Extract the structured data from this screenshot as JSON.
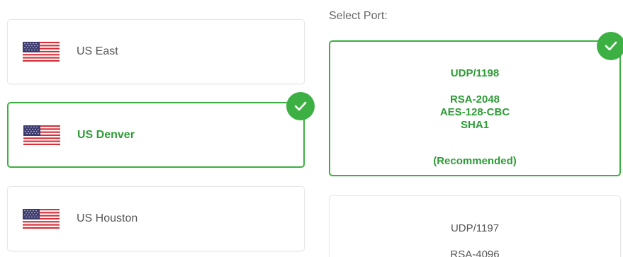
{
  "regions": [
    {
      "label": "US East",
      "selected": false
    },
    {
      "label": "US Denver",
      "selected": true
    },
    {
      "label": "US Houston",
      "selected": false
    }
  ],
  "port_section": {
    "heading": "Select Port:",
    "options": [
      {
        "selected": true,
        "port": "UDP/1198",
        "lines": [
          "RSA-2048",
          "AES-128-CBC",
          "SHA1"
        ],
        "note": "(Recommended)"
      },
      {
        "selected": false,
        "port": "UDP/1197",
        "lines": [
          "RSA-4096"
        ]
      }
    ]
  },
  "colors": {
    "accent_green": "#3db043",
    "selected_text": "#2d9c36",
    "card_border": "#e6e6e6",
    "text_gray": "#555555"
  },
  "icons": {
    "flag": "us-flag-icon",
    "check": "checkmark-icon"
  }
}
